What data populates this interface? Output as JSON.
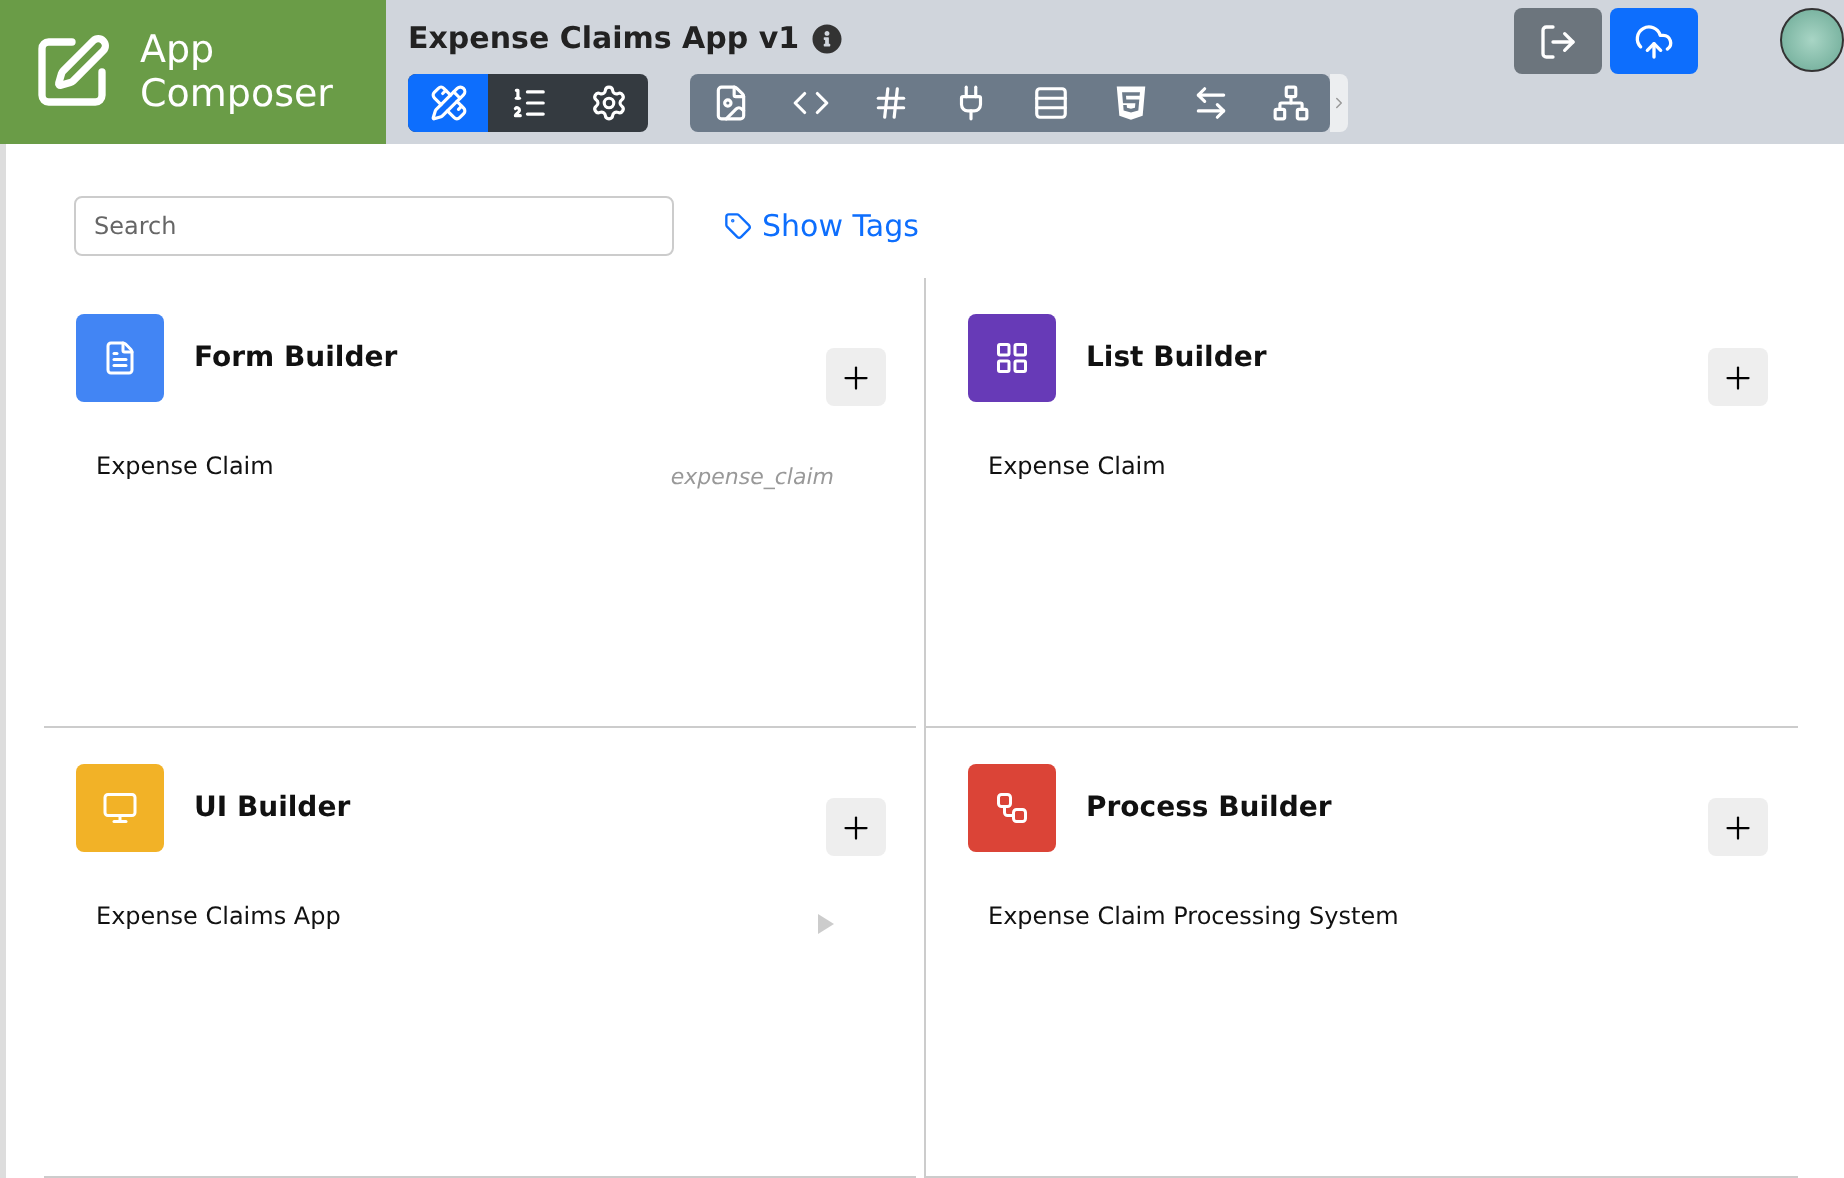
{
  "logo": {
    "line_1": "App",
    "line_2": "Composer"
  },
  "app_title": "Expense Claims App v1",
  "mode_tabs": [
    {
      "selected": true
    },
    {
      "selected": false
    },
    {
      "selected": false
    }
  ],
  "search": {
    "placeholder": "Search"
  },
  "show_tags": "Show Tags",
  "builders": [
    {
      "kind": "form",
      "title": "Form Builder",
      "color": "#4285f4",
      "items": [
        {
          "name": "Expense Claim",
          "tag": "expense_claim",
          "arrow": false
        }
      ]
    },
    {
      "kind": "list",
      "title": "List Builder",
      "color": "#673ab7",
      "items": [
        {
          "name": "Expense Claim",
          "arrow": false
        }
      ]
    },
    {
      "kind": "ui",
      "title": "UI Builder",
      "color": "#f2b227",
      "items": [
        {
          "name": "Expense Claims App",
          "arrow": true
        }
      ]
    },
    {
      "kind": "process",
      "title": "Process Builder",
      "color": "#db4437",
      "items": [
        {
          "name": "Expense Claim Processing System",
          "arrow": false
        }
      ]
    }
  ]
}
